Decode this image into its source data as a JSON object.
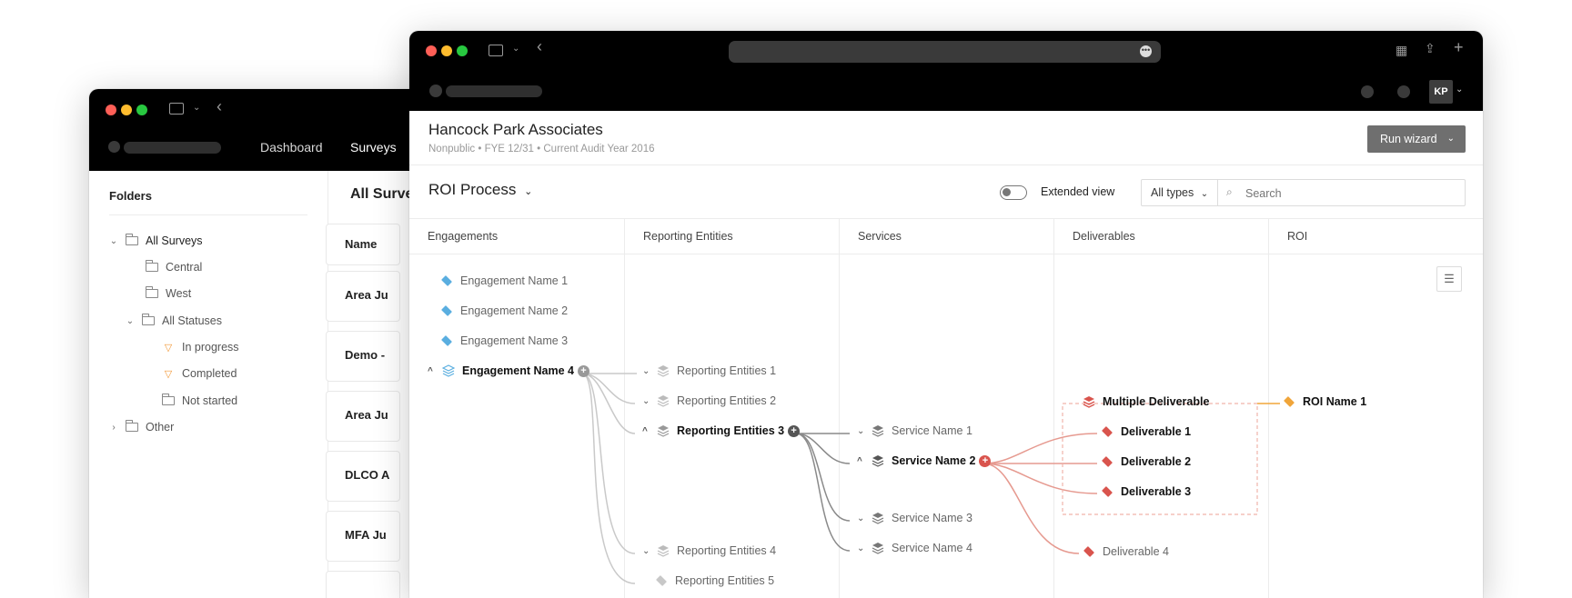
{
  "back_window": {
    "nav": {
      "dashboard": "Dashboard",
      "surveys": "Surveys"
    },
    "folders_title": "Folders",
    "folders": [
      {
        "label": "All Surveys",
        "type": "folder-open",
        "caret": "⌄"
      },
      {
        "label": "Central",
        "type": "folder"
      },
      {
        "label": "West",
        "type": "folder"
      },
      {
        "label": "All Statuses",
        "type": "folder-open",
        "caret": "⌄"
      },
      {
        "label": "In progress",
        "type": "filter"
      },
      {
        "label": "Completed",
        "type": "filter"
      },
      {
        "label": "Not started",
        "type": "folder"
      },
      {
        "label": "Other",
        "type": "folder",
        "caret": "›"
      }
    ],
    "list_title": "All Surve",
    "name_header": "Name",
    "rows": [
      "Area Ju",
      "Demo -",
      "Area Ju",
      "DLCO A",
      "MFA Ju"
    ]
  },
  "front_window": {
    "avatar": "KP",
    "company": "Hancock Park Associates",
    "meta": [
      "Nonpublic",
      "FYE 12/31",
      "Current Audit Year 2016"
    ],
    "run_wizard": "Run wizard",
    "process_title": "ROI Process",
    "extended_view": "Extended view",
    "type_filter": "All types",
    "search_placeholder": "Search",
    "columns": [
      "Engagements",
      "Reporting Entities",
      "Services",
      "Deliverables",
      "ROI"
    ],
    "engagements": [
      "Engagement Name 1",
      "Engagement Name 2",
      "Engagement Name 3",
      "Engagement Name 4"
    ],
    "reporting_entities": [
      "Reporting Entities 1",
      "Reporting Entities 2",
      "Reporting Entities 3",
      "Reporting Entities 4",
      "Reporting Entities 5"
    ],
    "services": [
      "Service Name 1",
      "Service Name 2",
      "Service Name 3",
      "Service Name 4"
    ],
    "deliverables": [
      "Multiple Deliverable",
      "Deliverable 1",
      "Deliverable 2",
      "Deliverable 3",
      "Deliverable 4"
    ],
    "roi": [
      "ROI Name 1"
    ],
    "colors": {
      "engagement": "#5aaee0",
      "deliverable": "#d9544d",
      "roi": "#f0a53a",
      "wizard": "#6f6f6f"
    }
  }
}
